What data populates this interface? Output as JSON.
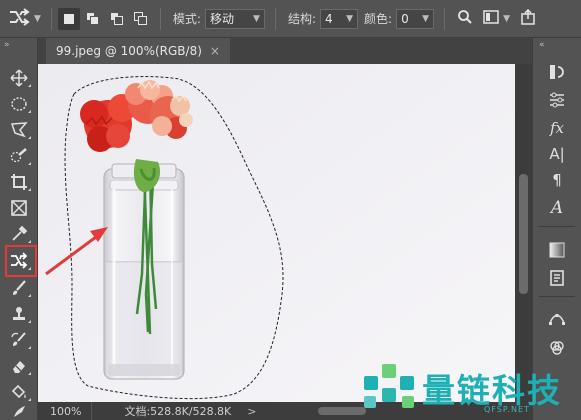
{
  "options_bar": {
    "mode_label": "模式:",
    "mode_value": "移动",
    "structure_label": "结构:",
    "structure_value": "4",
    "color_label": "颜色:",
    "color_value": "0"
  },
  "document": {
    "tab_title": "99.jpeg @ 100%(RGB/8)",
    "tab_close": "×"
  },
  "status_bar": {
    "zoom": "100%",
    "doc_info": "文档:528.8K/528.8K",
    "arrow": ">"
  },
  "toolbar": {
    "tools": [
      "move-tool",
      "elliptical-marquee-tool",
      "polygonal-lasso-tool",
      "quick-selection-tool",
      "crop-tool",
      "frame-tool",
      "eyedropper-tool",
      "content-aware-move-tool",
      "brush-tool",
      "clone-stamp-tool",
      "history-brush-tool",
      "eraser-tool",
      "paint-bucket-tool",
      "smudge-tool"
    ],
    "active_tool": "content-aware-move-tool"
  },
  "right_panel": {
    "panels": [
      "history-panel",
      "adjustments-panel",
      "styles-panel",
      "character-panel",
      "paragraph-panel",
      "glyphs-panel",
      "gradients-panel",
      "libraries-panel",
      "paths-panel",
      "channels-panel"
    ],
    "fx_label": "fx",
    "char_label": "A|",
    "para_label": "¶",
    "glyph_label": "A"
  },
  "watermark": {
    "text": "量链科技",
    "sub": "QFSP.NET"
  },
  "colors": {
    "ui_dark": "#535353",
    "canvas_bg": "#f1eff3",
    "highlight_red": "#e23b3b",
    "watermark_teal": "#1db0b5",
    "flower_red": "#e03a2c"
  }
}
